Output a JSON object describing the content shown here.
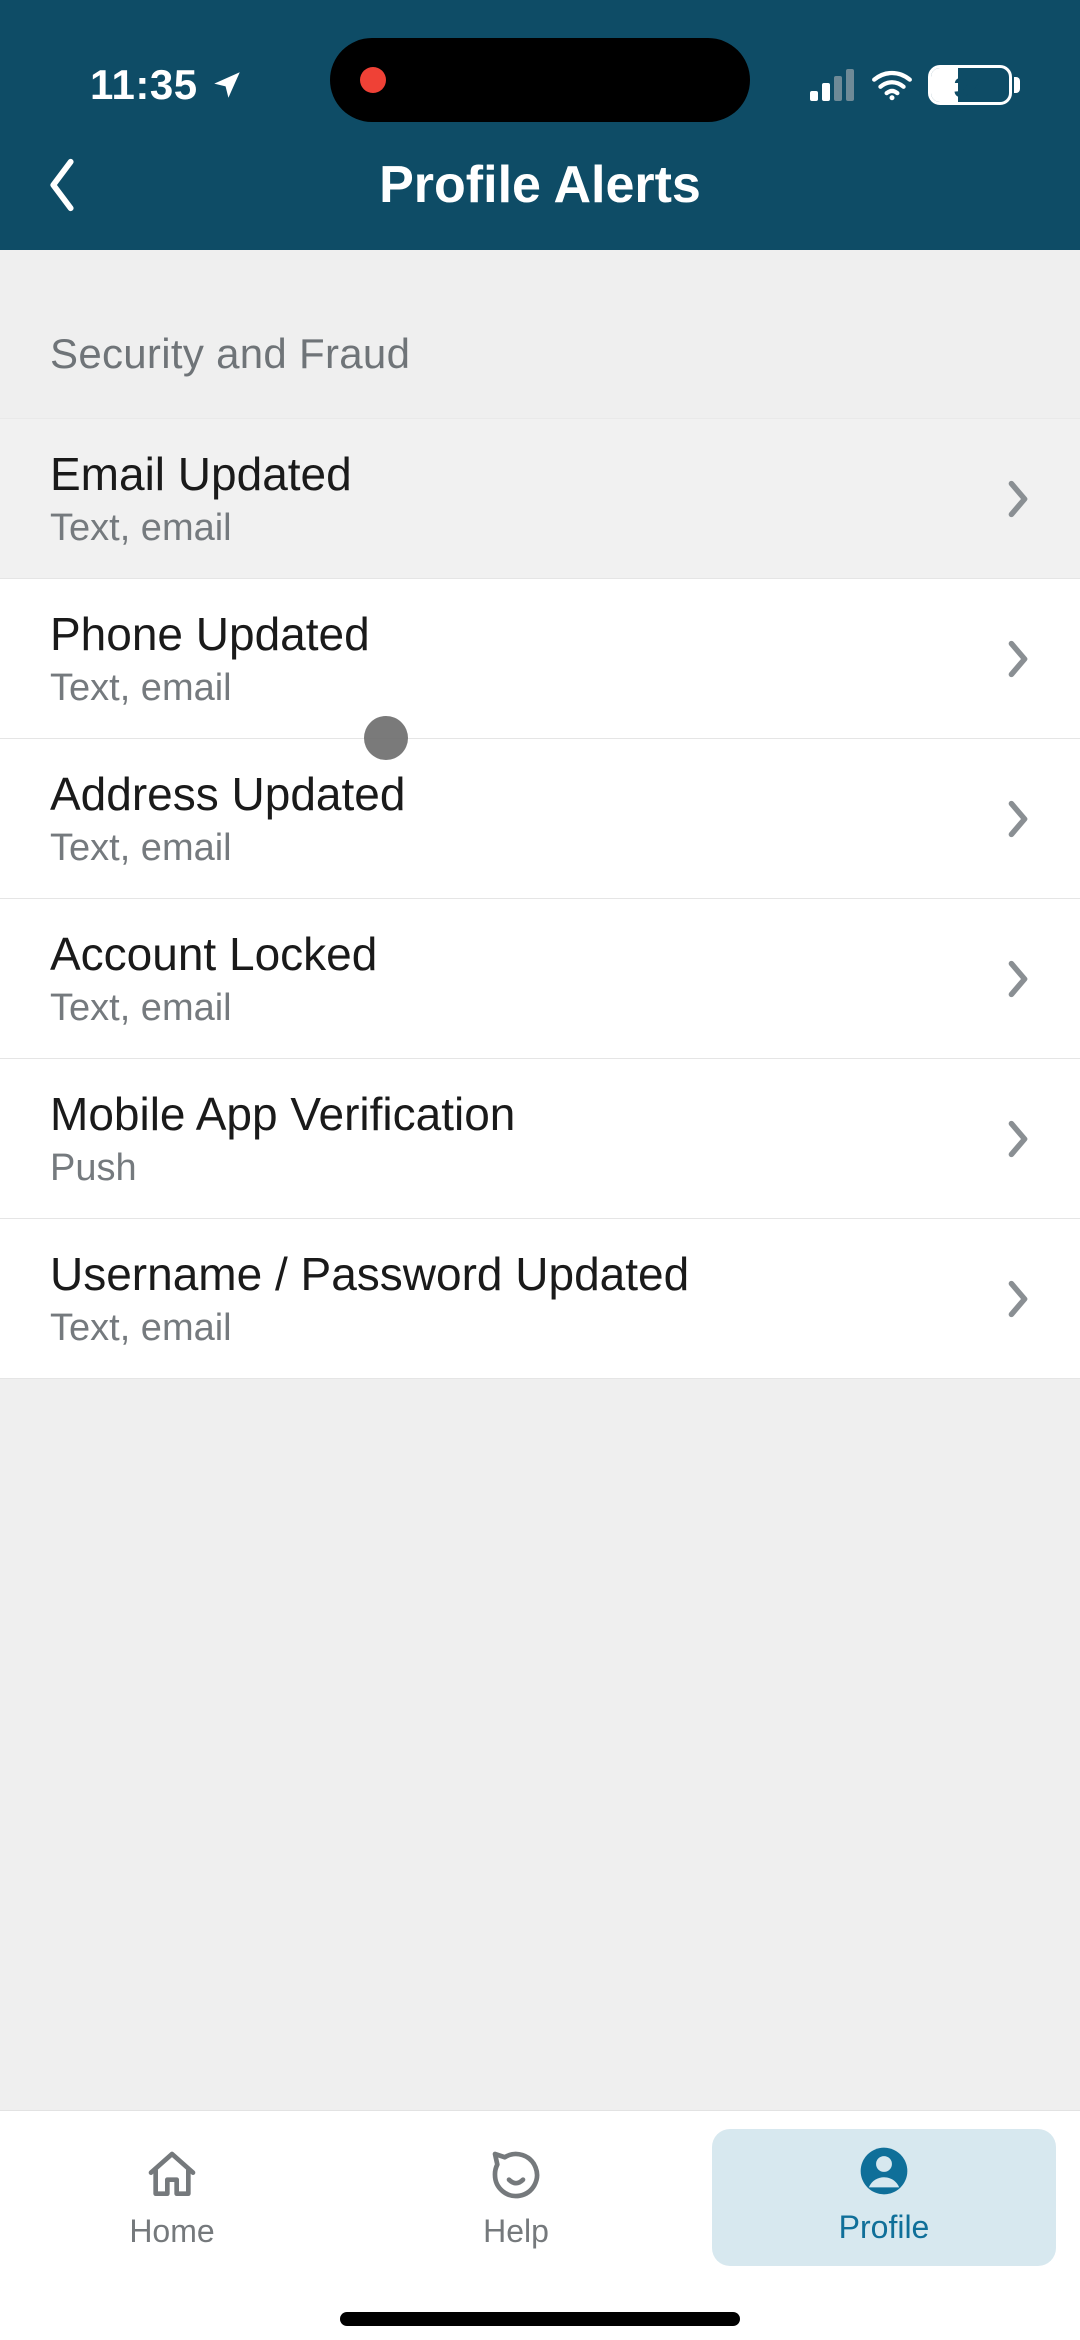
{
  "statusbar": {
    "time": "11:35",
    "battery": "34"
  },
  "header": {
    "title": "Profile Alerts"
  },
  "section": {
    "title": "Security and Fraud"
  },
  "alerts": [
    {
      "title": "Email Updated",
      "sub": "Text, email"
    },
    {
      "title": "Phone Updated",
      "sub": "Text, email"
    },
    {
      "title": "Address Updated",
      "sub": "Text, email"
    },
    {
      "title": "Account Locked",
      "sub": "Text, email"
    },
    {
      "title": "Mobile App Verification",
      "sub": "Push"
    },
    {
      "title": "Username / Password Updated",
      "sub": "Text, email"
    }
  ],
  "tabs": {
    "home": "Home",
    "help": "Help",
    "profile": "Profile"
  }
}
